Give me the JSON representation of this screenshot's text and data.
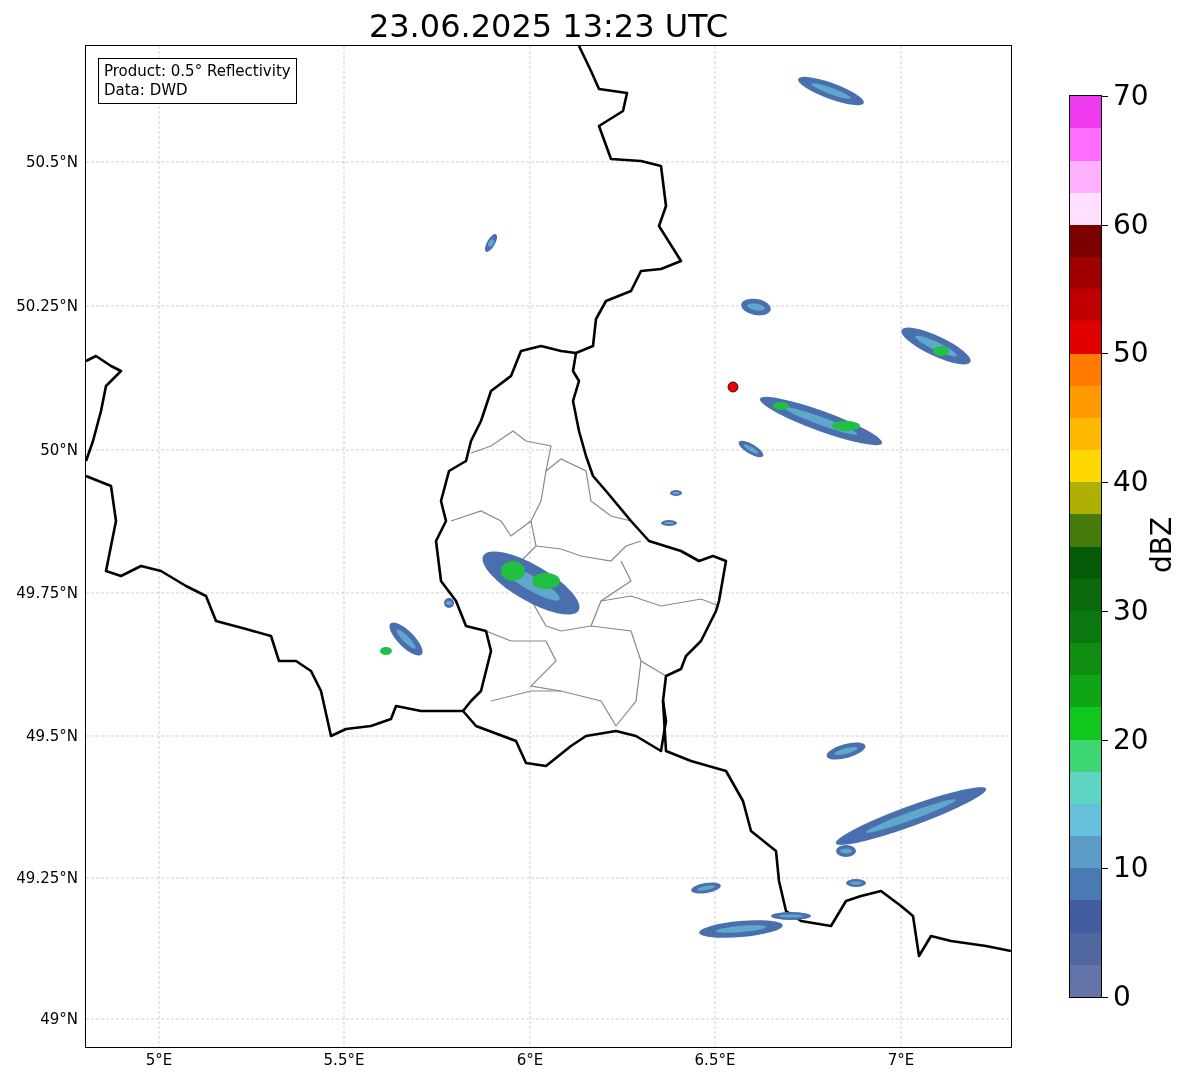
{
  "title": "23.06.2025 13:23 UTC",
  "legend": [
    "Product: 0.5° Reflectivity",
    "Data: DWD"
  ],
  "y_ticks": [
    {
      "label": "50.5°N"
    },
    {
      "label": "50.25°N"
    },
    {
      "label": "50°N"
    },
    {
      "label": "49.75°N"
    },
    {
      "label": "49.5°N"
    },
    {
      "label": "49.25°N"
    },
    {
      "label": "49°N"
    }
  ],
  "x_ticks": [
    {
      "label": "5°E"
    },
    {
      "label": "5.5°E"
    },
    {
      "label": "6°E"
    },
    {
      "label": "6.5°E"
    },
    {
      "label": "7°E"
    }
  ],
  "colorbar": {
    "label": "dBZ",
    "ticks": [
      {
        "label": "70"
      },
      {
        "label": "60"
      },
      {
        "label": "50"
      },
      {
        "label": "40"
      },
      {
        "label": "30"
      },
      {
        "label": "20"
      },
      {
        "label": "10"
      },
      {
        "label": "0"
      }
    ],
    "color_scale": [
      {
        "color": "#6474a8"
      },
      {
        "color": "#51679f"
      },
      {
        "color": "#425ea0"
      },
      {
        "color": "#4a7ab3"
      },
      {
        "color": "#5a9cc6"
      },
      {
        "color": "#66c0dc"
      },
      {
        "color": "#5fd6c4"
      },
      {
        "color": "#3dd672"
      },
      {
        "color": "#10c81c"
      },
      {
        "color": "#10a514"
      },
      {
        "color": "#0f8d10"
      },
      {
        "color": "#0c7810"
      },
      {
        "color": "#0a6a0d"
      },
      {
        "color": "#065b09"
      },
      {
        "color": "#467a0a"
      },
      {
        "color": "#aeb004"
      },
      {
        "color": "#ffd800"
      },
      {
        "color": "#ffb800"
      },
      {
        "color": "#ff9a00"
      },
      {
        "color": "#ff7c00"
      },
      {
        "color": "#e00000"
      },
      {
        "color": "#c00000"
      },
      {
        "color": "#a00000"
      },
      {
        "color": "#7c0000"
      },
      {
        "color": "#ffe0ff"
      },
      {
        "color": "#ffb0ff"
      },
      {
        "color": "#ff6eff"
      },
      {
        "color": "#ee3aee"
      }
    ]
  }
}
